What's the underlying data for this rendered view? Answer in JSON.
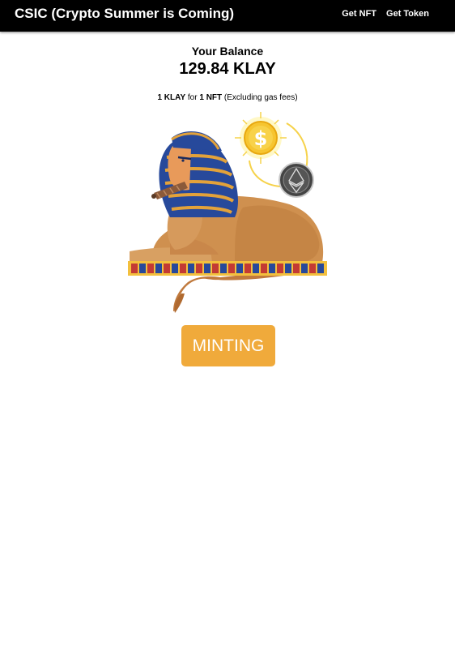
{
  "navbar": {
    "title": "CSIC (Crypto Summer is Coming)",
    "links": [
      "Get NFT",
      "Get Token"
    ]
  },
  "balance": {
    "label": "Your Balance",
    "amount": "129.84 KLAY"
  },
  "rate": {
    "klay_part": "1 KLAY",
    "for": "for",
    "nft_part": "1 NFT",
    "note": "(Excluding gas fees)"
  },
  "illustration": {
    "subject": "sphinx-with-coins",
    "icons": [
      "dollar-coin-icon",
      "ethereum-coin-icon"
    ]
  },
  "actions": {
    "mint_label": "MINTING"
  },
  "colors": {
    "navbar_bg": "#000000",
    "button_bg": "#f0aa3b",
    "button_text": "#ffffff"
  }
}
